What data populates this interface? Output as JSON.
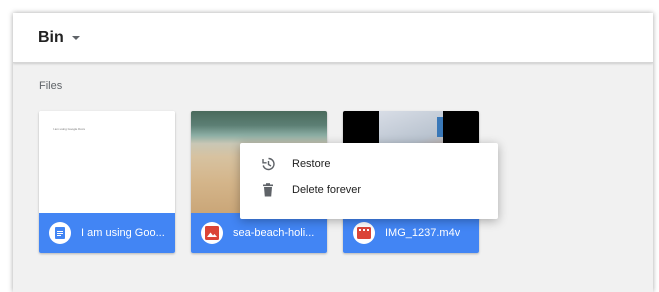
{
  "header": {
    "title": "Bin"
  },
  "section": {
    "label": "Files"
  },
  "files": [
    {
      "name": "I am using Goo...",
      "preview_text": "I am using Google Docs",
      "icon": "docs-icon",
      "icon_color": "#4285f4"
    },
    {
      "name": "sea-beach-holi...",
      "icon": "image-icon",
      "icon_color": "#db4437"
    },
    {
      "name": "IMG_1237.m4v",
      "icon": "video-icon",
      "icon_color": "#db4437"
    }
  ],
  "context_menu": {
    "items": [
      {
        "label": "Restore",
        "icon": "restore-icon"
      },
      {
        "label": "Delete forever",
        "icon": "trash-icon"
      }
    ]
  },
  "colors": {
    "accent": "#4285f4",
    "background": "#f1f1f1",
    "file_icon_red": "#db4437"
  }
}
